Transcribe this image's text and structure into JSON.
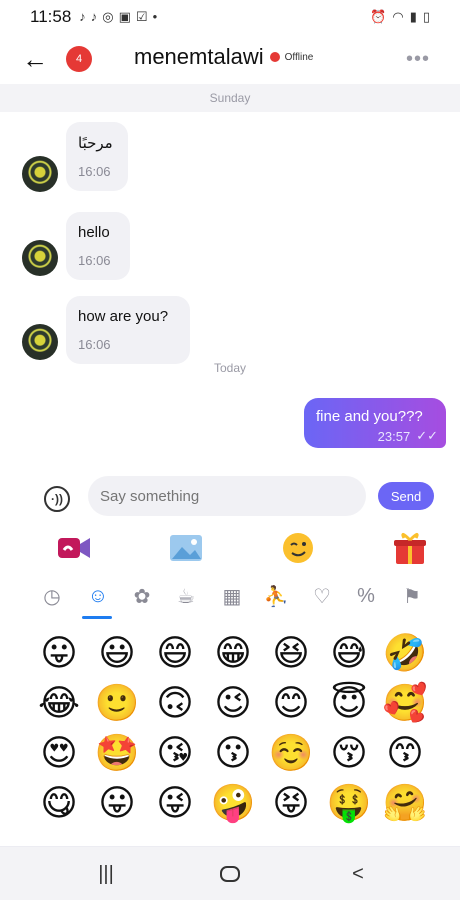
{
  "status_bar": {
    "time": "11:58",
    "icons": [
      "tiktok-icon",
      "tiktok-icon",
      "instagram-icon",
      "gallery-icon",
      "checkbox-icon",
      "dot-icon"
    ],
    "right_icons": [
      "alarm-icon",
      "wifi-icon",
      "signal-icon",
      "battery-icon"
    ]
  },
  "header": {
    "back_icon": "arrow-left-icon",
    "badge": "4",
    "title": "menemtalawi",
    "status": "Offline",
    "more_icon": "ellipsis-icon",
    "status_color": "#e53935"
  },
  "chat": {
    "day_sunday": "Sunday",
    "day_today": "Today",
    "messages_in": [
      {
        "text": "مرحبًا",
        "time": "16:06"
      },
      {
        "text": "hello",
        "time": "16:06"
      },
      {
        "text": "how are you?",
        "time": "16:06"
      }
    ],
    "message_out": {
      "text": "fine and you???",
      "time": "23:57",
      "status_icon": "double-check-icon"
    },
    "accent": "#6b66f5"
  },
  "composer": {
    "placeholder": "Say something",
    "send_label": "Send",
    "mic_icon": "voice-icon"
  },
  "tools": [
    "video-call-icon",
    "image-icon",
    "emoji-icon",
    "gift-icon"
  ],
  "emoji_categories": [
    "recent-icon",
    "smiley-icon",
    "paw-icon",
    "food-icon",
    "building-icon",
    "activity-icon",
    "lightbulb-icon",
    "symbols-icon",
    "flag-icon"
  ],
  "emoji_rows": [
    [
      "😛",
      "😃",
      "😄",
      "😁",
      "😆",
      "😅",
      "🤣"
    ],
    [
      "😂",
      "🙂",
      "🙃",
      "😉",
      "😊",
      "😇",
      "🥰"
    ],
    [
      "😍",
      "🤩",
      "😘",
      "😗",
      "☺️",
      "😚",
      "😙"
    ],
    [
      "😋",
      "😛",
      "😜",
      "🤪",
      "😝",
      "🤑",
      "🤗"
    ]
  ],
  "navbar": [
    "recent-apps-icon",
    "home-icon",
    "back-icon"
  ]
}
